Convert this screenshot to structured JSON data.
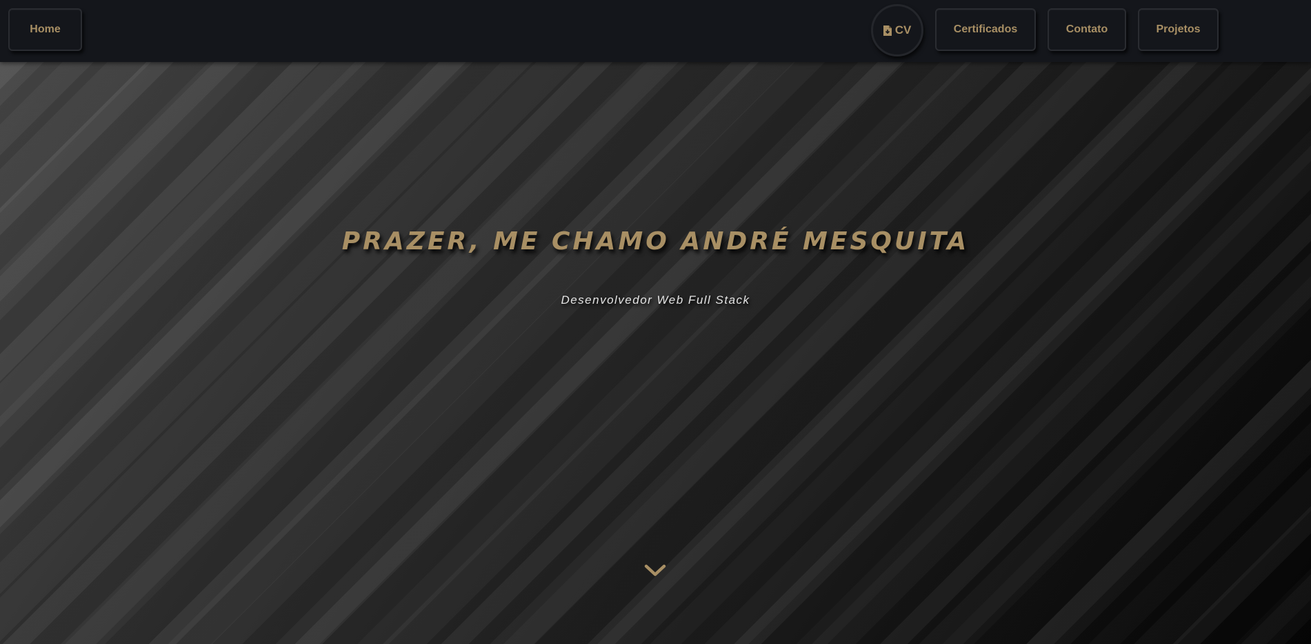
{
  "nav": {
    "home_label": "Home",
    "cv_label": "CV",
    "cv_icon": "file-download-icon",
    "certificados_label": "Certificados",
    "contato_label": "Contato",
    "projetos_label": "Projetos"
  },
  "hero": {
    "title": "PRAZER, ME CHAMO ANDRÉ MESQUITA",
    "subtitle": "Desenvolvedor Web Full Stack",
    "scroll_icon": "chevron-down-icon"
  },
  "colors": {
    "accent": "#a88f64",
    "nav_bg": "#14161b",
    "subtitle": "#e4e4e4"
  }
}
